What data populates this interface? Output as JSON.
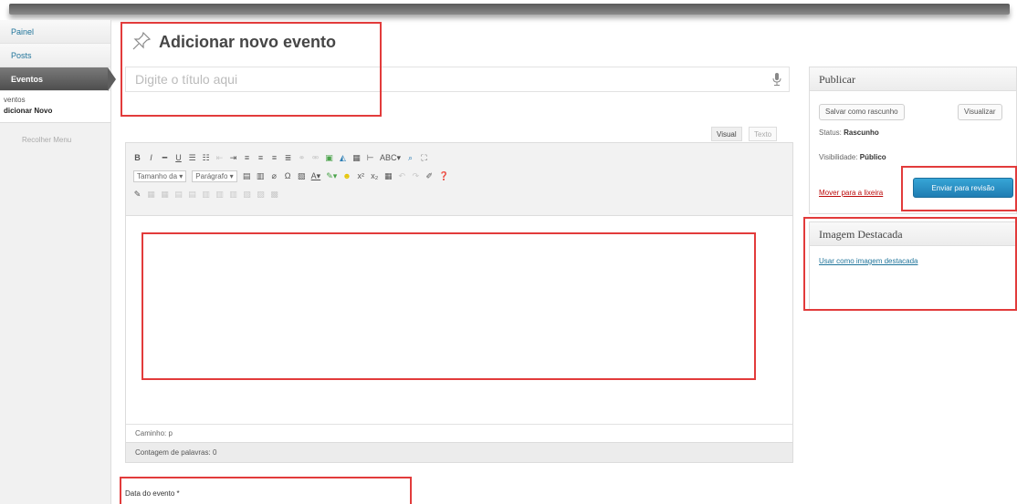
{
  "sidebar": {
    "items": [
      {
        "label": "Painel"
      },
      {
        "label": "Posts"
      },
      {
        "label": "Eventos"
      }
    ],
    "submenu": [
      {
        "label": "ventos"
      },
      {
        "label": "dicionar Novo"
      }
    ],
    "collapse_label": "Recolher Menu"
  },
  "page": {
    "title": "Adicionar novo evento",
    "title_placeholder": "Digite o título aqui"
  },
  "editor": {
    "tabs": {
      "visual": "Visual",
      "text": "Texto"
    },
    "toolbar": {
      "format_select": "Tamanho da",
      "paragraph_select": "Parágrafo"
    },
    "path_label": "Caminho: p",
    "word_count": "Contagem de palavras: 0"
  },
  "publish": {
    "header": "Publicar",
    "save_draft": "Salvar como rascunho",
    "preview": "Visualizar",
    "status_label": "Status: ",
    "status_value": "Rascunho",
    "visibility_label": "Visibilidade: ",
    "visibility_value": "Público",
    "trash_link": "Mover para a lixeira",
    "submit": "Enviar para revisão"
  },
  "featured_image": {
    "header": "Imagem Destacada",
    "link": "Usar como imagem destacada"
  },
  "event": {
    "date_label": "Data do evento *"
  },
  "colors": {
    "highlight": "#e23b3b",
    "primary": "#1f7db3",
    "link": "#21759b"
  }
}
